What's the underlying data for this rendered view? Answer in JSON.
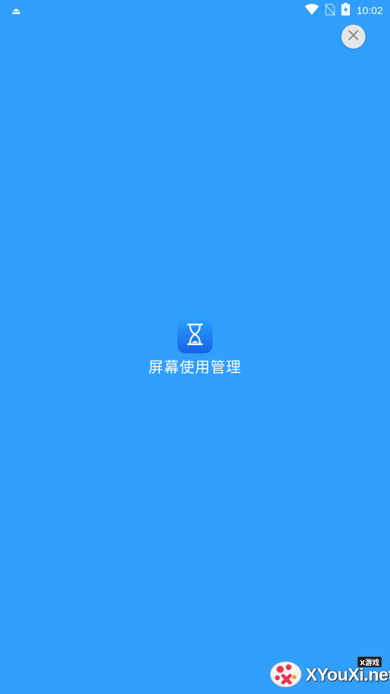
{
  "status_bar": {
    "time": "10:02",
    "icons": [
      "notification-icon",
      "wifi-icon",
      "no-sim-icon",
      "battery-charging-icon"
    ]
  },
  "close_button": {
    "icon": "close-icon"
  },
  "app": {
    "name": "屏幕使用管理",
    "icon": "hourglass-icon",
    "icon_colors": [
      "#2aa0ff",
      "#1763e8"
    ]
  },
  "watermark": {
    "text": "XYouXi.net",
    "badge": "X游戏"
  },
  "colors": {
    "background": "#2f9ffb",
    "close_button_bg": "#e6e6e6"
  }
}
